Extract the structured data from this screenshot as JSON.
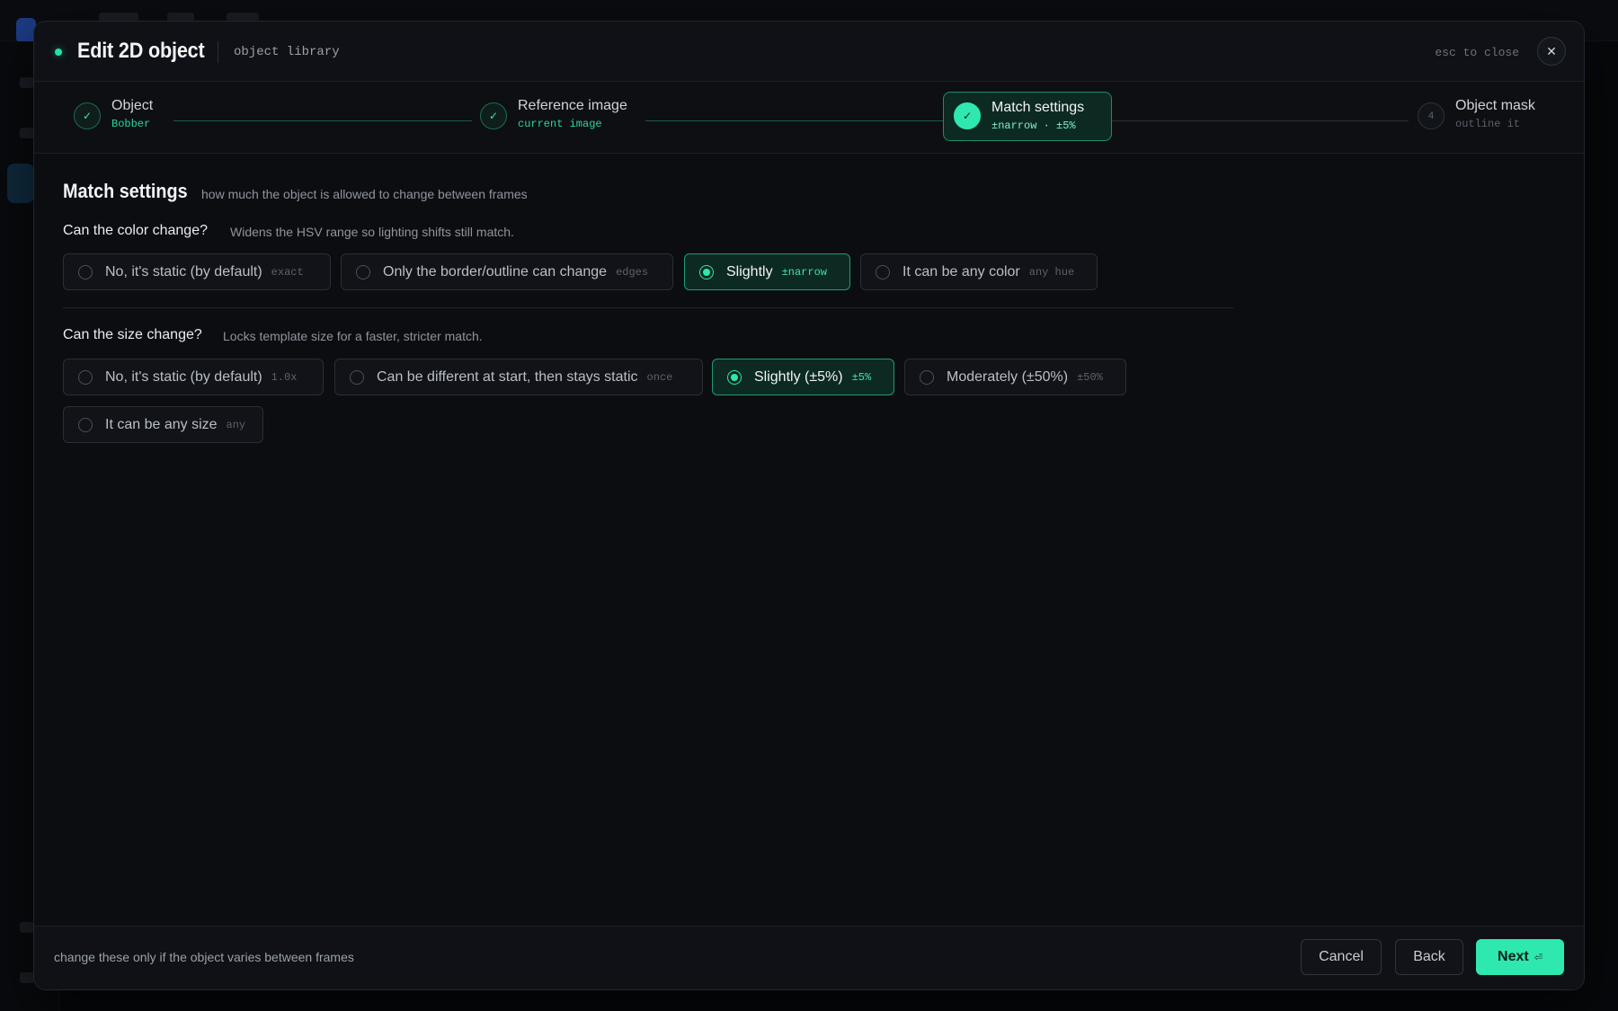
{
  "modal": {
    "title": "Edit 2D object",
    "library": "object library",
    "esc_hint": "esc to close",
    "close_glyph": "✕"
  },
  "colors": {
    "accent": "#2ee8b0",
    "background": "#0b0d11"
  },
  "stepper": [
    {
      "title": "Object",
      "sub": "Bobber",
      "marker": "✓",
      "state": "done"
    },
    {
      "title": "Reference image",
      "sub": "current image",
      "marker": "✓",
      "state": "done"
    },
    {
      "title": "Match settings",
      "sub": "±narrow · ±5%",
      "marker": "✓",
      "state": "active"
    },
    {
      "title": "Object mask",
      "sub": "outline it",
      "marker": "4",
      "state": "pending"
    }
  ],
  "section": {
    "title": "Match settings",
    "subtitle": "how much the object is allowed to change between frames"
  },
  "color_question": {
    "title": "Can the color change?",
    "hint": "Widens the HSV range so lighting shifts still match.",
    "options": [
      {
        "label": "No, it's static (by default)",
        "tag": "exact",
        "selected": false
      },
      {
        "label": "Only the border/outline can change",
        "tag": "edges",
        "selected": false
      },
      {
        "label": "Slightly",
        "tag": "±narrow",
        "selected": true
      },
      {
        "label": "It can be any color",
        "tag": "any hue",
        "selected": false
      }
    ]
  },
  "size_question": {
    "title": "Can the size change?",
    "hint": "Locks template size for a faster, stricter match.",
    "options": [
      {
        "label": "No, it's static (by default)",
        "tag": "1.0x",
        "selected": false
      },
      {
        "label": "Can be different at start, then stays static",
        "tag": "once",
        "selected": false
      },
      {
        "label": "Slightly (±5%)",
        "tag": "±5%",
        "selected": true
      },
      {
        "label": "Moderately (±50%)",
        "tag": "±50%",
        "selected": false
      },
      {
        "label": "It can be any size",
        "tag": "any",
        "selected": false
      }
    ]
  },
  "footer": {
    "note": "change these only if the object varies between frames",
    "cancel": "Cancel",
    "back": "Back",
    "next": "Next",
    "next_kbd": "⏎"
  }
}
